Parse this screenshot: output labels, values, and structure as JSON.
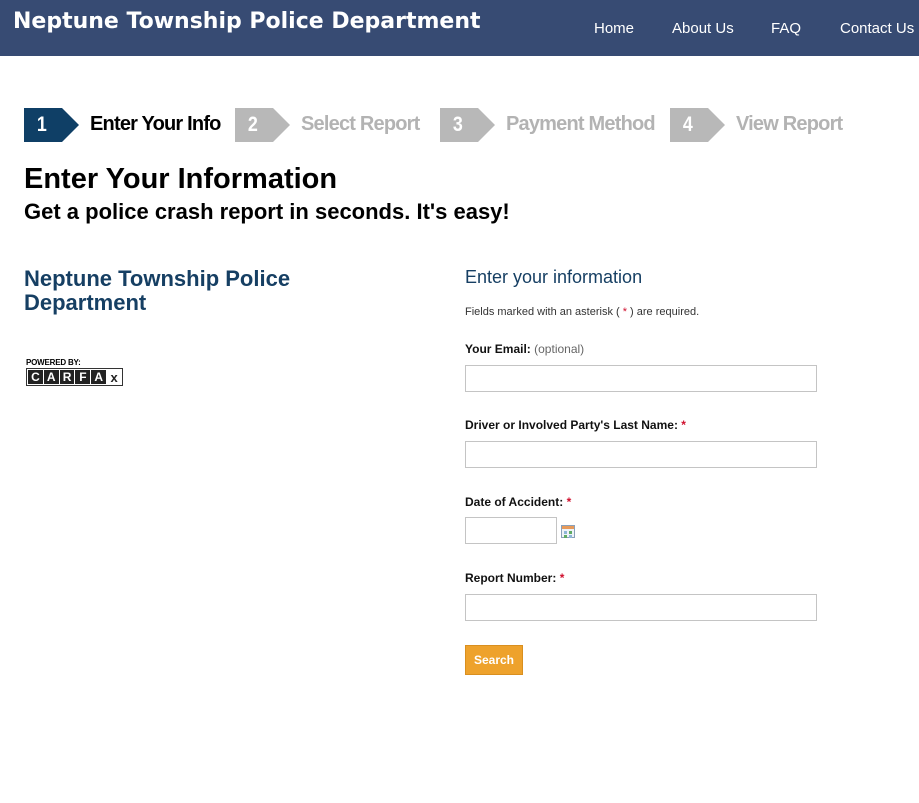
{
  "header": {
    "site_title": "Neptune Township Police Department",
    "nav": [
      {
        "label": "Home"
      },
      {
        "label": "About Us"
      },
      {
        "label": "FAQ"
      },
      {
        "label": "Contact Us"
      }
    ]
  },
  "steps": [
    {
      "number": "1",
      "label": "Enter Your Info",
      "state": "active"
    },
    {
      "number": "2",
      "label": "Select Report",
      "state": "inactive"
    },
    {
      "number": "3",
      "label": "Payment Method",
      "state": "inactive"
    },
    {
      "number": "4",
      "label": "View Report",
      "state": "inactive"
    }
  ],
  "page": {
    "title": "Enter Your Information",
    "subtitle": "Get a police crash report in seconds. It's easy!"
  },
  "sidebar": {
    "department_name": "Neptune Township Police Department",
    "powered_by": "POWERED BY:",
    "brand_letters": [
      "C",
      "A",
      "R",
      "F",
      "A",
      "x"
    ]
  },
  "form": {
    "title": "Enter your information",
    "required_note_prefix": "Fields marked with an asterisk ( ",
    "required_note_asterisk": "*",
    "required_note_suffix": " ) are required.",
    "fields": {
      "email": {
        "label": "Your Email:",
        "optional": "(optional)",
        "value": ""
      },
      "last_name": {
        "label": "Driver or Involved Party's Last Name:",
        "asterisk": "*",
        "value": ""
      },
      "date": {
        "label": "Date of Accident:",
        "asterisk": "*",
        "value": ""
      },
      "report_number": {
        "label": "Report Number:",
        "asterisk": "*",
        "value": ""
      }
    },
    "search_label": "Search"
  },
  "colors": {
    "header_bg": "#374b73",
    "step_active": "#0f3f66",
    "step_inactive": "#b8b8b8",
    "dept_text": "#163f63",
    "button_bg": "#eea22c",
    "required": "#d0102e"
  }
}
